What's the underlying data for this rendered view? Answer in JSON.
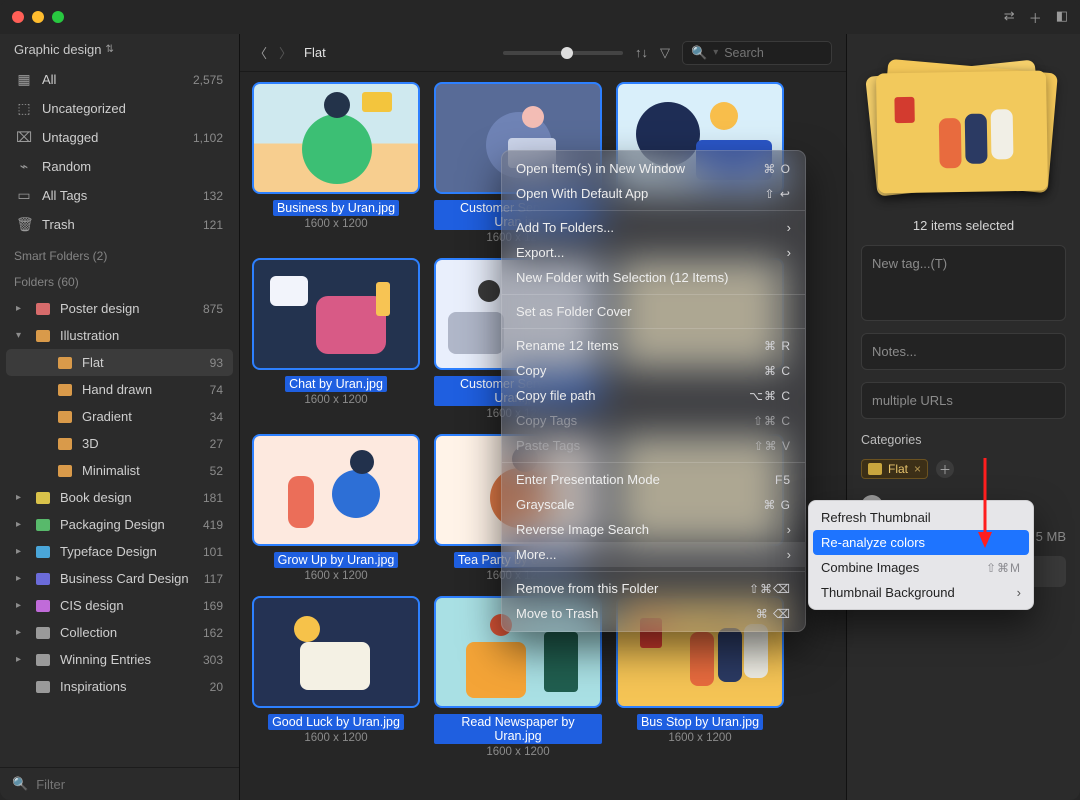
{
  "library_name": "Graphic design",
  "sidebar_top": [
    {
      "icon": "grid",
      "label": "All",
      "count": "2,575"
    },
    {
      "icon": "inbox",
      "label": "Uncategorized",
      "count": ""
    },
    {
      "icon": "tagx",
      "label": "Untagged",
      "count": "1,102"
    },
    {
      "icon": "bulb",
      "label": "Random",
      "count": ""
    },
    {
      "icon": "tag",
      "label": "All Tags",
      "count": "132"
    },
    {
      "icon": "trash",
      "label": "Trash",
      "count": "121"
    }
  ],
  "section_smart": "Smart Folders (2)",
  "section_folders": "Folders (60)",
  "folders": [
    {
      "label": "Poster design",
      "count": "875",
      "color": "#d76b6b",
      "arrow": "▸",
      "depth": 0
    },
    {
      "label": "Illustration",
      "count": "",
      "color": "#d99a4a",
      "arrow": "▾",
      "depth": 0
    },
    {
      "label": "Flat",
      "count": "93",
      "color": "#d99a4a",
      "arrow": "",
      "depth": 1,
      "selected": true
    },
    {
      "label": "Hand drawn",
      "count": "74",
      "color": "#d99a4a",
      "arrow": "",
      "depth": 1
    },
    {
      "label": "Gradient",
      "count": "34",
      "color": "#d99a4a",
      "arrow": "",
      "depth": 1
    },
    {
      "label": "3D",
      "count": "27",
      "color": "#d99a4a",
      "arrow": "",
      "depth": 1
    },
    {
      "label": "Minimalist",
      "count": "52",
      "color": "#d99a4a",
      "arrow": "",
      "depth": 1
    },
    {
      "label": "Book design",
      "count": "181",
      "color": "#d9c24a",
      "arrow": "▸",
      "depth": 0
    },
    {
      "label": "Packaging Design",
      "count": "419",
      "color": "#58b96b",
      "arrow": "▸",
      "depth": 0
    },
    {
      "label": "Typeface Design",
      "count": "101",
      "color": "#4aa6d9",
      "arrow": "▸",
      "depth": 0
    },
    {
      "label": "Business Card Design",
      "count": "117",
      "color": "#6b6bd9",
      "arrow": "▸",
      "depth": 0
    },
    {
      "label": "CIS design",
      "count": "169",
      "color": "#c06bd9",
      "arrow": "▸",
      "depth": 0
    },
    {
      "label": "Collection",
      "count": "162",
      "color": "#9a9a9a",
      "arrow": "▸",
      "depth": 0
    },
    {
      "label": "Winning Entries",
      "count": "303",
      "color": "#9a9a9a",
      "arrow": "▸",
      "depth": 0
    },
    {
      "label": "Inspirations",
      "count": "20",
      "color": "#9a9a9a",
      "arrow": "",
      "depth": 0
    }
  ],
  "filter_placeholder": "Filter",
  "toolbar": {
    "path": "Flat",
    "search_placeholder": "Search"
  },
  "items": [
    {
      "name": "Business by Uran.jpg",
      "dim": "1600 x 1200",
      "cls": "t-business"
    },
    {
      "name": "Customer Service by Uran.jpg",
      "dim": "1600 x 1200",
      "cls": "t-customer1"
    },
    {
      "name": "",
      "dim": "",
      "cls": "t-girl"
    },
    {
      "name": "Chat by Uran.jpg",
      "dim": "1600 x 1200",
      "cls": "t-chat"
    },
    {
      "name": "Customer Service by Uran.jpg",
      "dim": "1600 x 1200",
      "cls": "t-cs2"
    },
    {
      "name": "",
      "dim": "",
      "cls": ""
    },
    {
      "name": "Grow Up by Uran.jpg",
      "dim": "1600 x 1200",
      "cls": "t-grow"
    },
    {
      "name": "Tea Party by Uran.jpg",
      "dim": "1600 x 1200",
      "cls": "t-tea"
    },
    {
      "name": "",
      "dim": "",
      "cls": ""
    },
    {
      "name": "Good Luck by Uran.jpg",
      "dim": "1600 x 1200",
      "cls": "t-luck"
    },
    {
      "name": "Read Newspaper by Uran.jpg",
      "dim": "1600 x 1200",
      "cls": "t-news"
    },
    {
      "name": "Bus Stop by Uran.jpg",
      "dim": "1600 x 1200",
      "cls": "t-bus"
    }
  ],
  "inspector": {
    "title": "12 items selected",
    "tag_placeholder": "New tag...(T)",
    "notes_placeholder": "Notes...",
    "url_placeholder": "multiple URLs",
    "categories_label": "Categories",
    "chip": "Flat",
    "size_text": "5 MB",
    "export": "Export..."
  },
  "ctx1": {
    "open_new": "Open Item(s) in New Window",
    "open_new_sc": "⌘ O",
    "open_default": "Open With Default App",
    "open_default_sc": "⇧ ↩",
    "add_folders": "Add To Folders...",
    "export": "Export...",
    "new_folder": "New Folder with Selection (12 Items)",
    "set_cover": "Set as Folder Cover",
    "rename": "Rename 12 Items",
    "rename_sc": "⌘  R",
    "copy": "Copy",
    "copy_sc": "⌘  C",
    "copy_path": "Copy file path",
    "copy_path_sc": "⌥⌘ C",
    "copy_tags": "Copy Tags",
    "copy_tags_sc": "⇧⌘ C",
    "paste_tags": "Paste Tags",
    "paste_tags_sc": "⇧⌘ V",
    "presentation": "Enter Presentation Mode",
    "presentation_sc": "F5",
    "grayscale": "Grayscale",
    "grayscale_sc": "⌘  G",
    "reverse": "Reverse Image Search",
    "more": "More...",
    "remove": "Remove from this Folder",
    "remove_sc": "⇧⌘⌫",
    "trash": "Move to Trash",
    "trash_sc": "⌘ ⌫"
  },
  "ctx2": {
    "refresh": "Refresh Thumbnail",
    "reanalyze": "Re-analyze colors",
    "combine": "Combine Images",
    "combine_sc": "⇧⌘M",
    "thumb_bg": "Thumbnail Background"
  }
}
